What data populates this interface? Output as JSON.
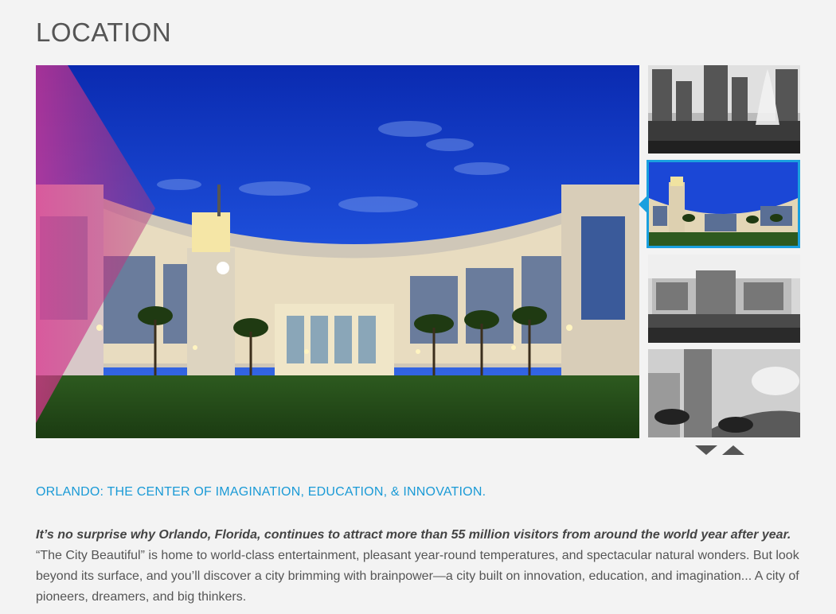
{
  "page": {
    "title": "LOCATION"
  },
  "gallery": {
    "main_image": {
      "description_icon": "campus-building-photo"
    },
    "thumbnails": [
      {
        "name": "orlando-skyline-fountain-thumbnail",
        "active": false
      },
      {
        "name": "campus-building-thumbnail",
        "active": true
      },
      {
        "name": "resort-hotel-thumbnail",
        "active": false
      },
      {
        "name": "tower-palms-thumbnail",
        "active": false
      }
    ],
    "controls": {
      "down_icon": "triangle-down-icon",
      "up_icon": "triangle-up-icon"
    }
  },
  "content": {
    "subheading": "ORLANDO: THE CENTER OF IMAGINATION, EDUCATION, & INNOVATION.",
    "lead": "It’s no surprise why Orlando, Florida, continues to attract more than 55 million visitors from around the world year after year.",
    "body": "“The City Beautiful” is home to world-class entertainment, pleasant year-round temperatures, and spectacular natural wonders. But look beyond its surface, and you’ll discover a city brimming with brainpower—a city built on innovation, education, and imagination... A city of pioneers, dreamers, and big thinkers."
  },
  "colors": {
    "accent": "#1aa0df",
    "background": "#f3f3f3",
    "text": "#555555"
  }
}
